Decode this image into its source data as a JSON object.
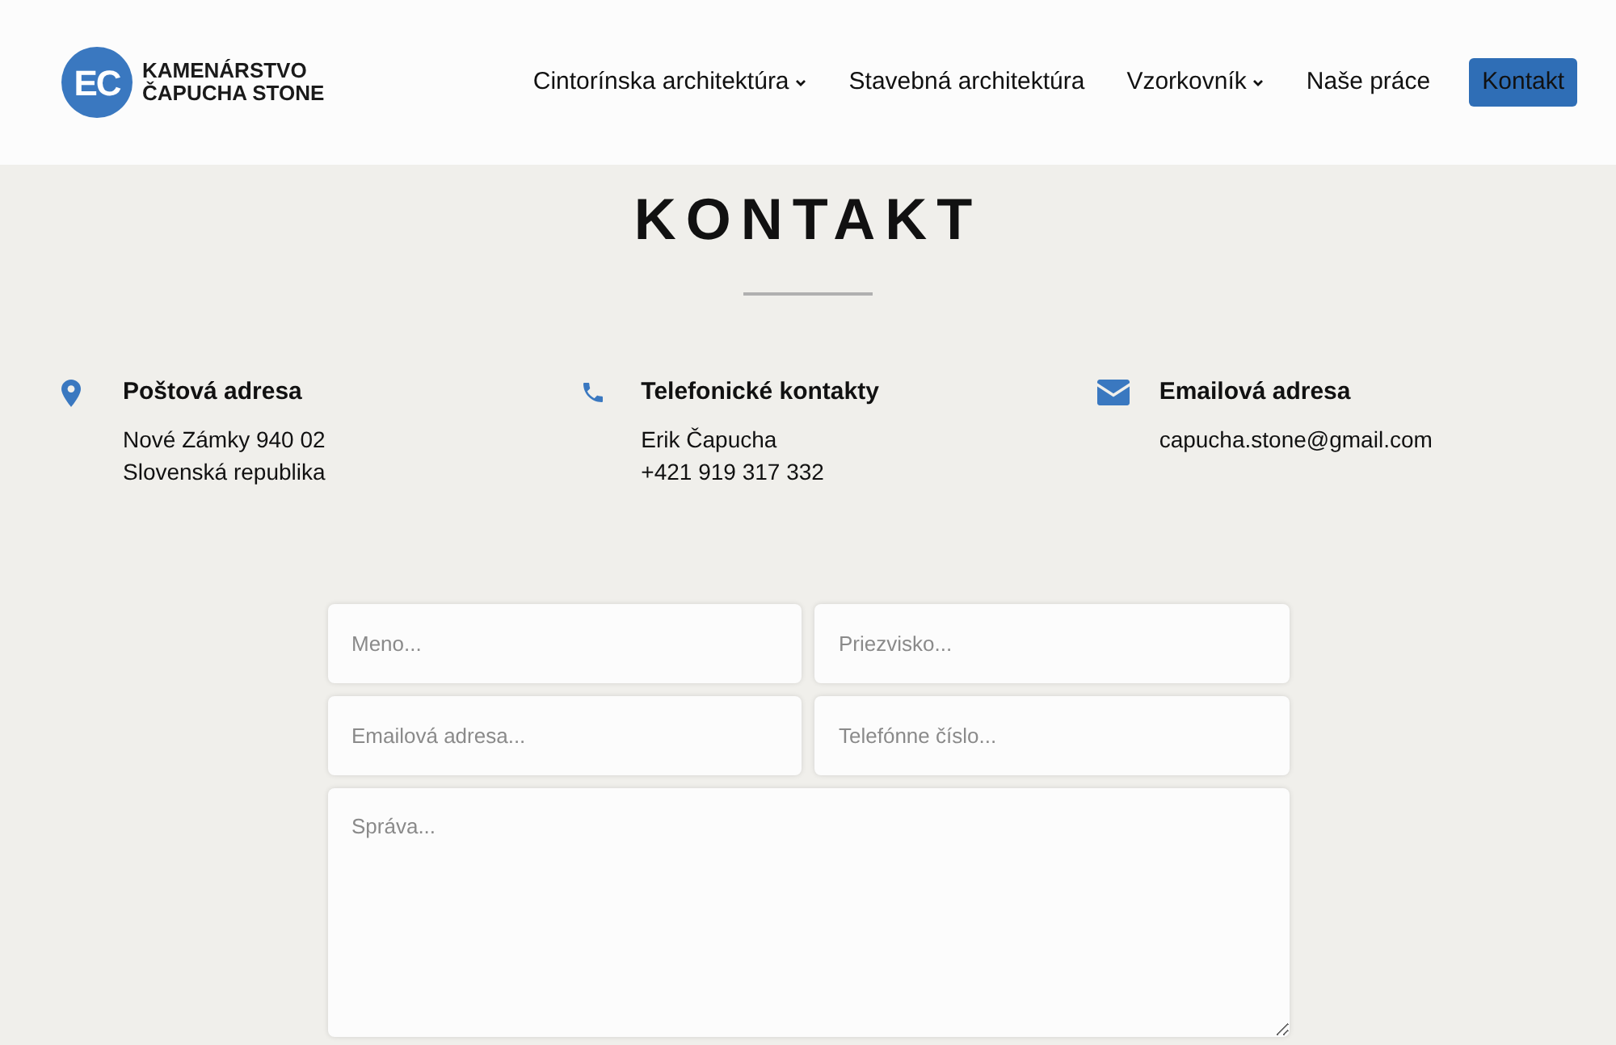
{
  "logo": {
    "mark": "EC",
    "line1": "KAMENÁRSTVO",
    "line2": "ČAPUCHA STONE"
  },
  "nav": [
    {
      "label": "Cintorínska architektúra",
      "dropdown": true,
      "selected": false
    },
    {
      "label": "Stavebná architektúra",
      "dropdown": false,
      "selected": false
    },
    {
      "label": "Vzorkovník",
      "dropdown": true,
      "selected": false
    },
    {
      "label": "Naše práce",
      "dropdown": false,
      "selected": false
    },
    {
      "label": "Kontakt",
      "dropdown": false,
      "selected": true
    }
  ],
  "title": "KONTAKT",
  "contacts": [
    {
      "kind": "pin",
      "heading": "Poštová adresa",
      "lines": [
        "Nové Zámky 940 02",
        "Slovenská republika"
      ]
    },
    {
      "kind": "phone",
      "heading": "Telefonické kontakty",
      "lines": [
        "Erik Čapucha",
        "+421 919 317 332"
      ]
    },
    {
      "kind": "mail",
      "heading": "Emailová adresa",
      "lines": [
        "capucha.stone@gmail.com"
      ]
    }
  ],
  "form": {
    "fields": [
      {
        "placeholder": "Meno..."
      },
      {
        "placeholder": "Priezvisko..."
      },
      {
        "placeholder": "Emailová adresa..."
      },
      {
        "placeholder": "Telefónne číslo..."
      }
    ],
    "message": {
      "placeholder": "Správa..."
    }
  }
}
